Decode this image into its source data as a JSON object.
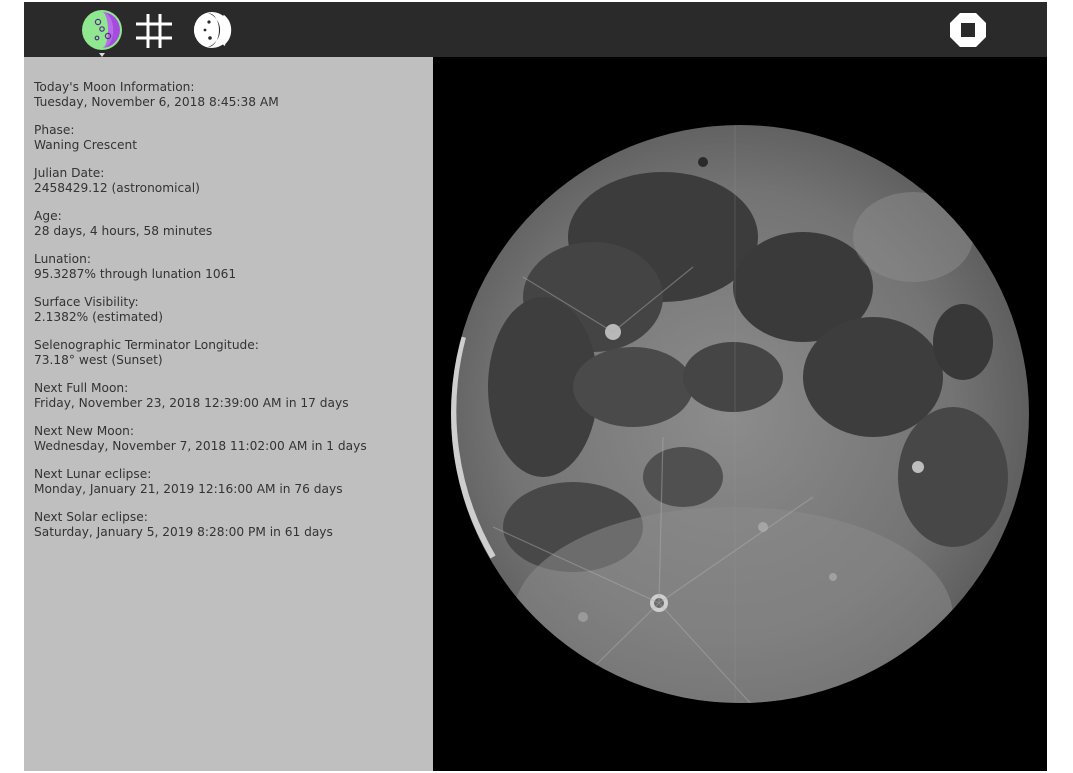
{
  "toolbar": {
    "icons": [
      "moon-info-icon",
      "grid-icon",
      "moon-phase-refresh-icon",
      "stop-icon"
    ],
    "accent_colors": {
      "info_icon_green": "#8fe88f",
      "info_icon_purple": "#a64be0",
      "background": "#2a2a2a"
    }
  },
  "info": {
    "header_label": "Today's Moon Information:",
    "header_value": "Tuesday, November 6, 2018 8:45:38 AM",
    "phase_label": "Phase:",
    "phase_value": "Waning Crescent",
    "julian_label": "Julian Date:",
    "julian_value": "2458429.12 (astronomical)",
    "age_label": "Age:",
    "age_value": "28 days, 4 hours, 58 minutes",
    "lunation_label": "Lunation:",
    "lunation_value": "95.3287% through lunation 1061",
    "visibility_label": "Surface Visibility:",
    "visibility_value": "2.1382% (estimated)",
    "terminator_label": "Selenographic Terminator Longitude:",
    "terminator_value": "73.18° west (Sunset)",
    "full_moon_label": "Next Full Moon:",
    "full_moon_value": "Friday, November 23, 2018 12:39:00 AM in 17 days",
    "new_moon_label": "Next New Moon:",
    "new_moon_value": "Wednesday, November 7, 2018 11:02:00 AM in 1 days",
    "lunar_eclipse_label": "Next Lunar eclipse:",
    "lunar_eclipse_value": "Monday, January 21, 2019 12:16:00 AM in 76 days",
    "solar_eclipse_label": "Next Solar eclipse:",
    "solar_eclipse_value": "Saturday, January 5, 2019 8:28:00 PM in 61 days"
  }
}
